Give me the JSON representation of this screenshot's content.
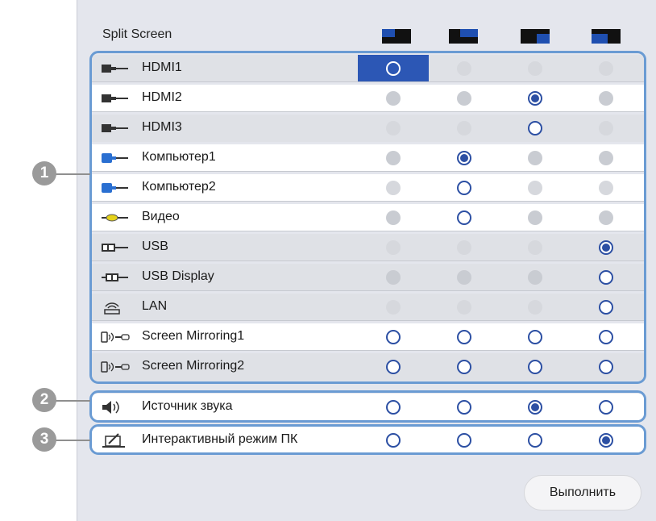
{
  "header": {
    "title": "Split Screen",
    "layouts": [
      "layout-top-left-icon",
      "layout-top-right-icon",
      "layout-bottom-right-icon",
      "layout-bottom-left-icon"
    ]
  },
  "sources": [
    {
      "label": "HDMI1",
      "icon": "hdmi-icon",
      "cells": [
        "selected",
        "disabled",
        "disabled",
        "disabled"
      ]
    },
    {
      "label": "HDMI2",
      "icon": "hdmi-icon",
      "cells": [
        "gray",
        "gray",
        "checked",
        "gray"
      ]
    },
    {
      "label": "HDMI3",
      "icon": "hdmi-icon",
      "cells": [
        "faint",
        "faint",
        "empty",
        "faint"
      ]
    },
    {
      "label": "Компьютер1",
      "icon": "computer-vga-icon",
      "cells": [
        "gray",
        "checked",
        "gray",
        "gray"
      ]
    },
    {
      "label": "Компьютер2",
      "icon": "computer-vga-icon",
      "cells": [
        "faint",
        "empty",
        "faint",
        "faint"
      ]
    },
    {
      "label": "Видео",
      "icon": "video-rca-icon",
      "cells": [
        "gray",
        "empty",
        "gray",
        "gray"
      ]
    },
    {
      "label": "USB",
      "icon": "usb-icon",
      "cells": [
        "faint",
        "faint",
        "faint",
        "checked"
      ]
    },
    {
      "label": "USB Display",
      "icon": "usb-display-icon",
      "cells": [
        "gray",
        "gray",
        "gray",
        "empty"
      ]
    },
    {
      "label": "LAN",
      "icon": "lan-wireless-icon",
      "cells": [
        "faint",
        "faint",
        "faint",
        "empty"
      ]
    },
    {
      "label": "Screen Mirroring1",
      "icon": "screen-mirroring-icon",
      "cells": [
        "empty",
        "empty",
        "empty",
        "empty"
      ]
    },
    {
      "label": "Screen Mirroring2",
      "icon": "screen-mirroring-icon",
      "cells": [
        "empty",
        "empty",
        "empty",
        "empty"
      ]
    }
  ],
  "audio": {
    "label": "Источник звука",
    "icon": "speaker-icon",
    "cells": [
      "empty",
      "empty",
      "checked",
      "empty"
    ]
  },
  "interactive": {
    "label": "Интерактивный режим ПК",
    "icon": "pen-interactive-icon",
    "cells": [
      "empty",
      "empty",
      "empty",
      "checked"
    ]
  },
  "callouts": [
    "1",
    "2",
    "3"
  ],
  "execute_label": "Выполнить",
  "colors": {
    "accent": "#2c4fa3",
    "selected_cell": "#2c57b5",
    "group_border": "#6a9bd3",
    "panel_bg": "#e4e6ed"
  }
}
